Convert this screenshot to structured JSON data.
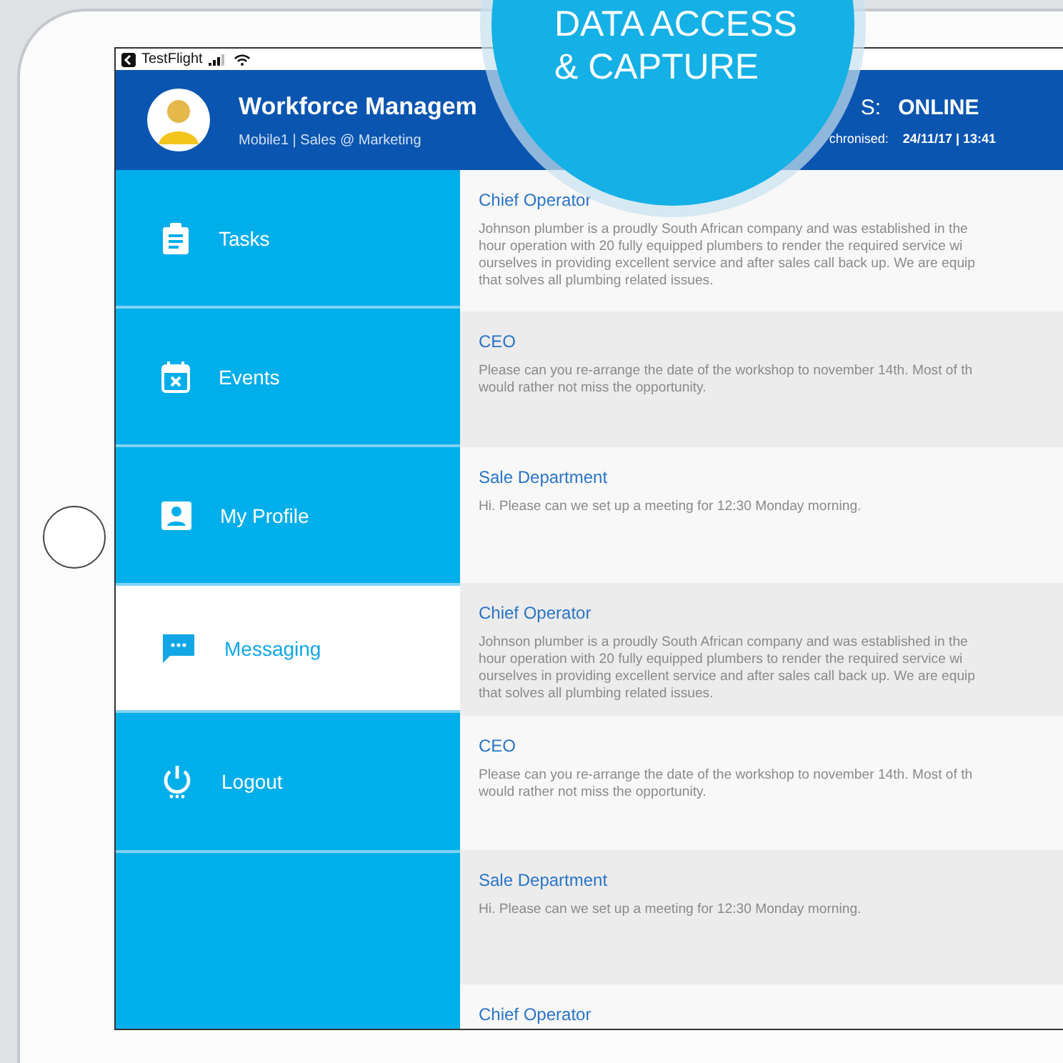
{
  "badge": {
    "lines": [
      "DATA ACCESS",
      "& CAPTURE"
    ]
  },
  "status_bar": {
    "app": "TestFlight"
  },
  "header": {
    "title": "Workforce Managem",
    "subtitle": "Mobile1 | Sales @ Marketing",
    "status_label": "S:",
    "status": "ONLINE",
    "sync_label": "chronised:",
    "sync_time": "24/11/17 | 13:41"
  },
  "sidebar": {
    "items": [
      {
        "label": "Tasks",
        "selected": false
      },
      {
        "label": "Events",
        "selected": false
      },
      {
        "label": "My Profile",
        "selected": false
      },
      {
        "label": "Messaging",
        "selected": true
      },
      {
        "label": "Logout",
        "selected": false
      }
    ]
  },
  "messages": [
    {
      "sender": "Chief Operator",
      "lines": [
        "Johnson plumber is a proudly South African company and was established in the",
        "hour operation with 20 fully equipped plumbers to render the required service wi",
        "ourselves in providing excellent service and after sales call back up. We are equip",
        "that solves all plumbing related issues."
      ]
    },
    {
      "sender": "CEO",
      "lines": [
        "Please can you re-arrange the date of the workshop to november 14th. Most of th",
        "would rather not miss the opportunity."
      ]
    },
    {
      "sender": "Sale Department",
      "lines": [
        "Hi. Please can we set up a meeting for 12:30 Monday morning."
      ]
    },
    {
      "sender": "Chief Operator",
      "lines": [
        "Johnson plumber is a proudly South African company and was established in the",
        "hour operation with 20 fully equipped plumbers to render the required service wi",
        "ourselves in providing excellent service and after sales call back up. We are equip",
        "that solves all plumbing related issues."
      ]
    },
    {
      "sender": "CEO",
      "lines": [
        "Please can you re-arrange the date of the workshop to november 14th. Most of th",
        "would rather not miss the opportunity."
      ]
    },
    {
      "sender": "Sale Department",
      "lines": [
        "Hi. Please can we set up a meeting for 12:30 Monday morning."
      ]
    },
    {
      "sender": "Chief Operator"
    }
  ]
}
